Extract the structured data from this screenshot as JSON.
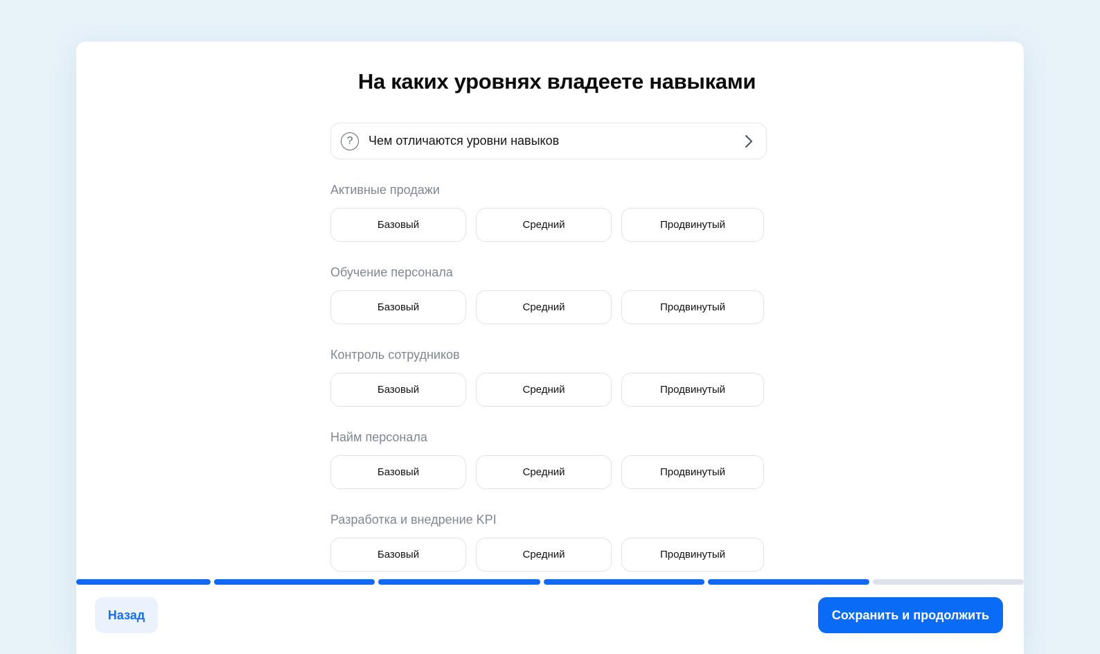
{
  "page": {
    "title": "На каких уровнях владеете навыками"
  },
  "info": {
    "icon": "question-circle-icon",
    "text": "Чем отличаются уровни навыков",
    "chevron": "chevron-right-icon"
  },
  "skills": [
    {
      "label": "Активные продажи",
      "levels": [
        "Базовый",
        "Средний",
        "Продвинутый"
      ]
    },
    {
      "label": "Обучение персонала",
      "levels": [
        "Базовый",
        "Средний",
        "Продвинутый"
      ]
    },
    {
      "label": "Контроль сотрудников",
      "levels": [
        "Базовый",
        "Средний",
        "Продвинутый"
      ]
    },
    {
      "label": "Найм персонала",
      "levels": [
        "Базовый",
        "Средний",
        "Продвинутый"
      ]
    },
    {
      "label": "Разработка и внедрение KPI",
      "levels": [
        "Базовый",
        "Средний",
        "Продвинутый"
      ]
    }
  ],
  "progress": {
    "total_steps": 6,
    "completed_steps": 5,
    "active_color": "#1168f3",
    "inactive_color": "#dde2e8"
  },
  "footer": {
    "back_label": "Назад",
    "save_label": "Сохранить и продолжить"
  },
  "colors": {
    "primary": "#0a6cf5",
    "background": "#e8f2f9"
  }
}
